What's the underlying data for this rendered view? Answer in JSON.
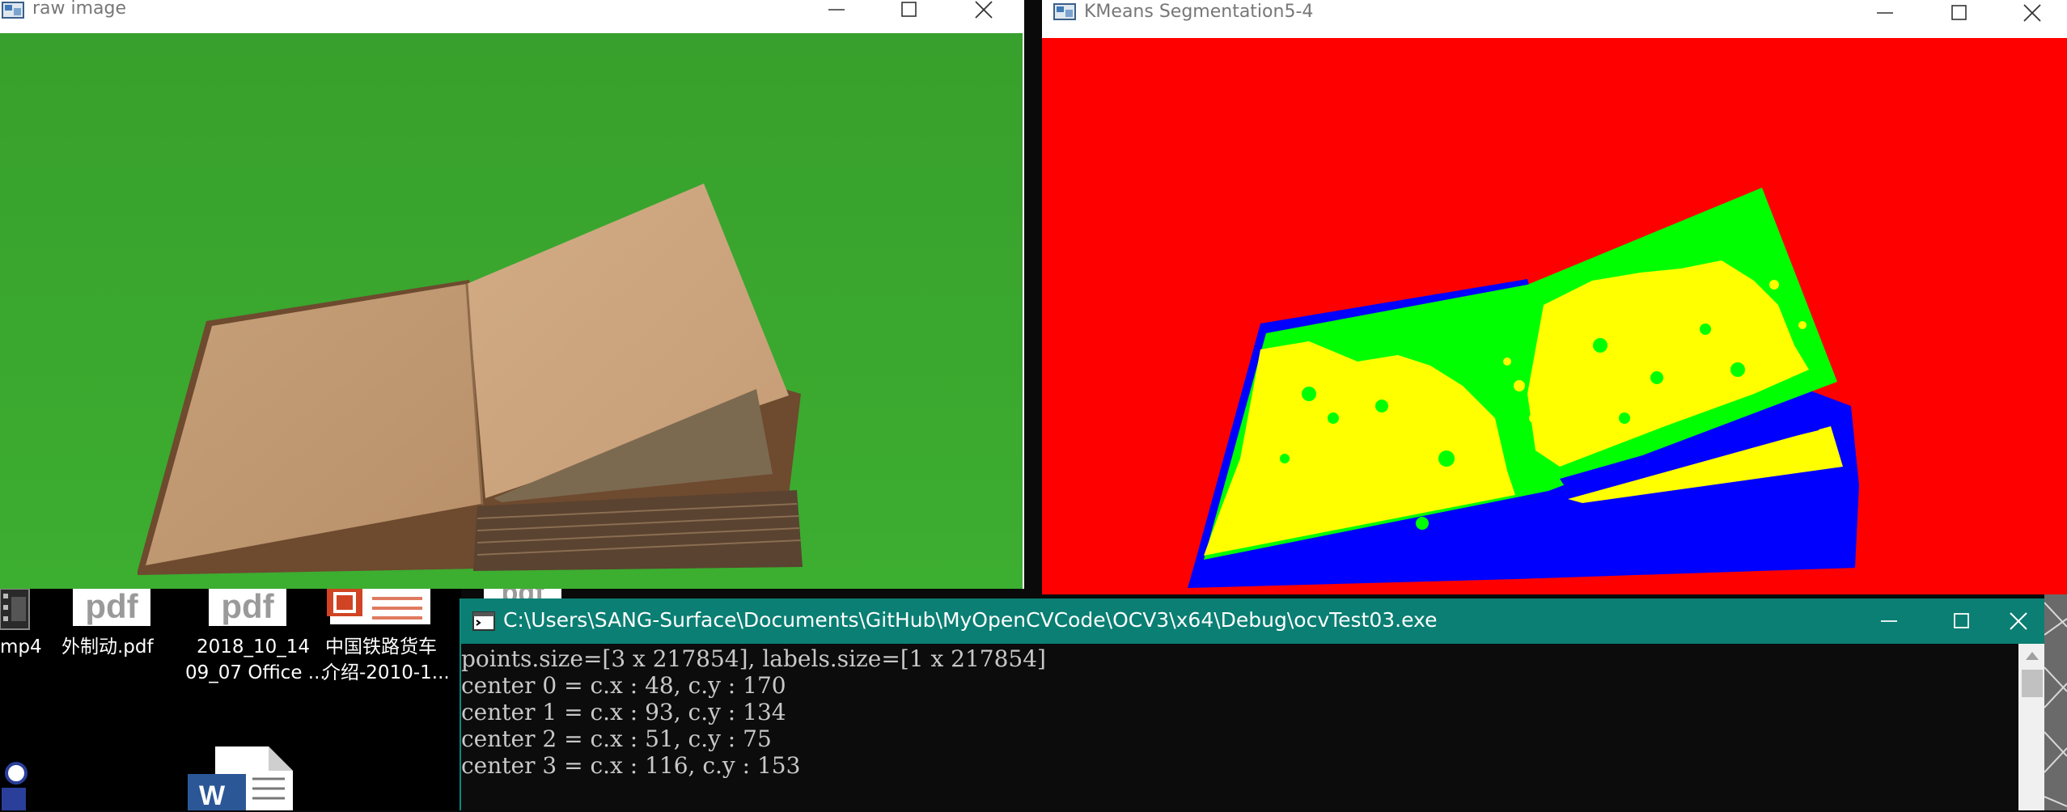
{
  "raw_window": {
    "title": "raw image",
    "colors": {
      "background": "#3aa02e",
      "book": "#c79f78"
    }
  },
  "kmeans_window": {
    "title": "KMeans Segmentation5-4",
    "colors": {
      "cluster_0": "#ff0000",
      "cluster_1": "#00ff00",
      "cluster_2": "#0000ff",
      "cluster_3": "#ffff00"
    }
  },
  "desktop": {
    "icons": [
      {
        "label_lines": [
          "mp4"
        ],
        "type": "video-file-icon"
      },
      {
        "label_lines": [
          "外制动.pdf"
        ],
        "tile_text": "pdf",
        "type": "pdf-file-icon"
      },
      {
        "label_lines": [
          "2018_10_14",
          "09_07 Office ..."
        ],
        "tile_text": "pdf",
        "type": "pdf-file-icon"
      },
      {
        "label_lines": [
          "中国铁路货车",
          "介绍-2010-1..."
        ],
        "type": "powerpoint-file-icon"
      },
      {
        "label_lines": [],
        "tile_text": "pdf",
        "type": "pdf-file-icon"
      }
    ]
  },
  "console": {
    "title": "C:\\Users\\SANG-Surface\\Documents\\GitHub\\MyOpenCVCode\\OCV3\\x64\\Debug\\ocvTest03.exe",
    "lines": [
      "points.size=[3 x 217854], labels.size=[1 x 217854]",
      "center 0 = c.x : 48, c.y : 170",
      "center 1 = c.x : 93, c.y : 134",
      "center 2 = c.x : 51, c.y : 75",
      "center 3 = c.x : 116, c.y : 153"
    ],
    "accent": "#0b7f73"
  }
}
